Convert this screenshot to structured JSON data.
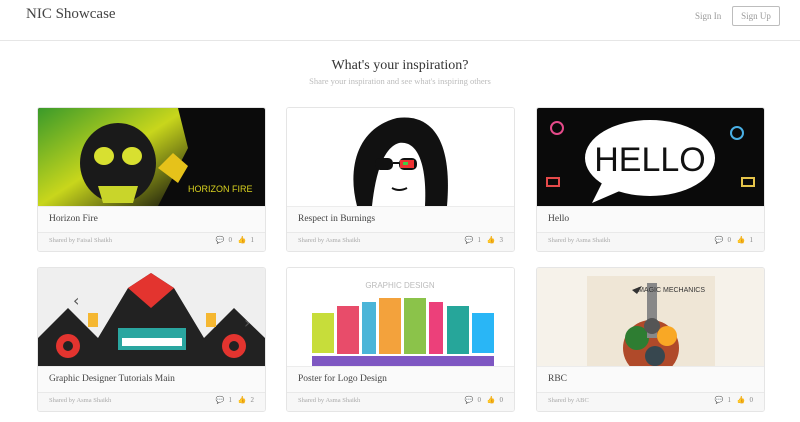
{
  "brand": "NIC Showcase",
  "nav": {
    "signin": "Sign In",
    "signup": "Sign Up"
  },
  "hero": {
    "title": "What's your inspiration?",
    "subtitle": "Share your inspiration and see what's inspiring others"
  },
  "cards": [
    {
      "title": "Horizon Fire",
      "shared_by": "Shared by Faisal Shaikh",
      "comments": "0",
      "likes": "1",
      "thumb_text": "HORIZON FIRE"
    },
    {
      "title": "Respect in Burnings",
      "shared_by": "Shared by Asma Shaikh",
      "comments": "1",
      "likes": "3"
    },
    {
      "title": "Hello",
      "shared_by": "Shared by Asma Shaikh",
      "comments": "0",
      "likes": "1",
      "thumb_text": "HELLO"
    },
    {
      "title": "Graphic Designer Tutorials Main",
      "shared_by": "Shared by Asma Shaikh",
      "comments": "1",
      "likes": "2"
    },
    {
      "title": "Poster for Logo Design",
      "shared_by": "Shared by Asma Shaikh",
      "comments": "0",
      "likes": "0",
      "thumb_text": "GRAPHIC DESIGN"
    },
    {
      "title": "RBC",
      "shared_by": "Shared by ABC",
      "comments": "1",
      "likes": "0",
      "thumb_text": "MAGIC MECHANICS"
    }
  ],
  "icons": {
    "comment": "comment-icon",
    "like": "thumbs-up-icon"
  }
}
